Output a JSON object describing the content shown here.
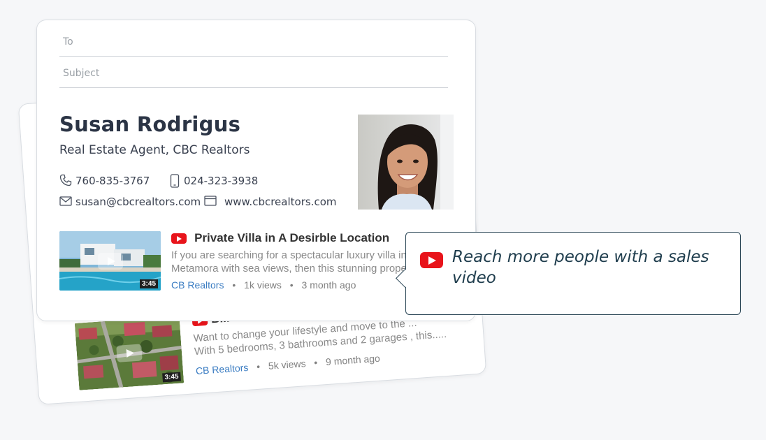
{
  "email": {
    "to_label": "To",
    "subject_label": "Subject"
  },
  "signature": {
    "name": "Susan Rodrigus",
    "title": "Real Estate Agent, CBC Realtors",
    "phone": "760-835-3767",
    "mobile": "024-323-3938",
    "email": "susan@cbcrealtors.com",
    "website": "www.cbcrealtors.com"
  },
  "videos": [
    {
      "title": "Private Villa in A Desirble Location",
      "desc_line1": "If you are searching for a spectacular luxury villa in",
      "desc_line2": "Metamora with sea views, then this stunning property",
      "duration": "3:45",
      "channel": "CB Realtors",
      "views": "1k views",
      "age": "3 month ago"
    },
    {
      "title": "B...",
      "desc_line1": "Want to change your lifestyle and move to the ...",
      "desc_line2": "With 5 bedrooms, 3 bathrooms and 2 garages , this.....",
      "duration": "3:45",
      "channel": "CB Realtors",
      "views": "5k views",
      "age": "9 month ago"
    }
  ],
  "callout": {
    "text": "Reach more people with a sales video"
  },
  "colors": {
    "youtube_red": "#e8141b",
    "link_blue": "#3a7cc2",
    "callout_border": "#2a4656"
  }
}
